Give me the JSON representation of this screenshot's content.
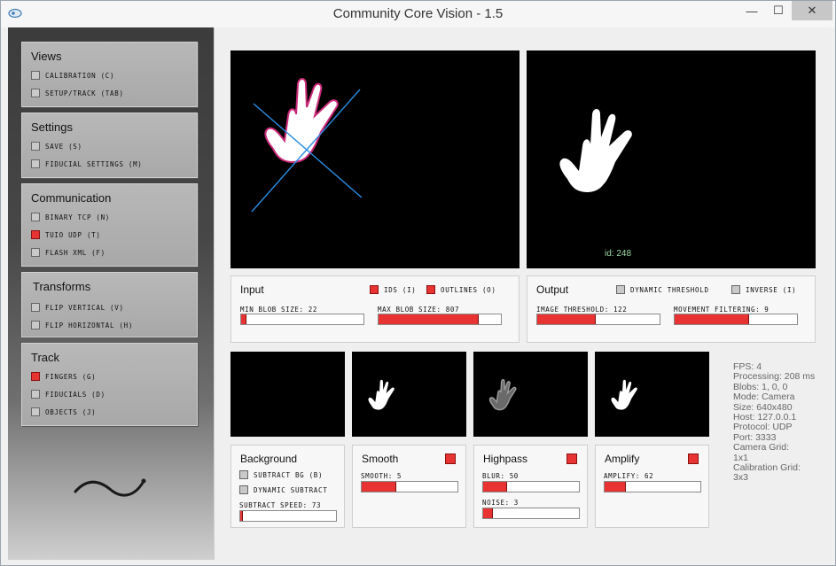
{
  "window": {
    "title": "Community Core Vision - 1.5"
  },
  "titlebar": {
    "minimize_symbol": "—",
    "maximize_symbol": "☐",
    "close_symbol": "✕"
  },
  "sidebar": {
    "views": {
      "title": "Views",
      "items": [
        {
          "label": "CALIBRATION (C)",
          "checked": false
        },
        {
          "label": "SETUP/TRACK (TAB)",
          "checked": false
        }
      ]
    },
    "settings": {
      "title": "Settings",
      "items": [
        {
          "label": "SAVE (S)",
          "checked": false
        },
        {
          "label": "FIDUCIAL SETTINGS (M)",
          "checked": false
        }
      ]
    },
    "communication": {
      "title": "Communication",
      "items": [
        {
          "label": "BINARY TCP (N)",
          "checked": false
        },
        {
          "label": "TUIO UDP (T)",
          "checked": true
        },
        {
          "label": "FLASH XML (F)",
          "checked": false
        }
      ]
    },
    "transforms": {
      "title": "Transforms",
      "items": [
        {
          "label": "FLIP VERTICAL (V)",
          "checked": false
        },
        {
          "label": "FLIP HORIZONTAL (H)",
          "checked": false
        }
      ]
    },
    "track": {
      "title": "Track",
      "items": [
        {
          "label": "FINGERS (G)",
          "checked": true
        },
        {
          "label": "FIDUCIALS (D)",
          "checked": false
        },
        {
          "label": "OBJECTS (J)",
          "checked": false
        }
      ]
    }
  },
  "output_view": {
    "blob_id": "id: 248"
  },
  "input": {
    "title": "Input",
    "ids_label": "IDS (I)",
    "ids_checked": true,
    "outlines_label": "OUTLINES (O)",
    "outlines_checked": true,
    "min_blob_label": "MIN BLOB SIZE: 22",
    "min_blob_fill": 0.04,
    "max_blob_label": "MAX BLOB SIZE: 807",
    "max_blob_fill": 0.82
  },
  "output": {
    "title": "Output",
    "dynamic_threshold_label": "DYNAMIC THRESHOLD",
    "dynamic_threshold_checked": false,
    "inverse_label": "INVERSE (I)",
    "inverse_checked": false,
    "image_threshold_label": "IMAGE THRESHOLD: 122",
    "image_threshold_fill": 0.48,
    "movement_filtering_label": "MOVEMENT FILTERING: 9",
    "movement_filtering_fill": 0.61
  },
  "filters": {
    "background": {
      "title": "Background",
      "subtract_bg_label": "SUBTRACT BG (B)",
      "subtract_bg_checked": false,
      "dynamic_subtract_label": "DYNAMIC SUBTRACT",
      "dynamic_subtract_checked": false,
      "subtract_speed_label": "SUBTRACT SPEED: 73",
      "subtract_speed_fill": 0.03
    },
    "smooth": {
      "title": "Smooth",
      "enabled": true,
      "slider_label": "SMOOTH: 5",
      "slider_fill": 0.36
    },
    "highpass": {
      "title": "Highpass",
      "enabled": true,
      "blur_label": "BLUR: 50",
      "blur_fill": 0.25,
      "noise_label": "NOISE: 3",
      "noise_fill": 0.1
    },
    "amplify": {
      "title": "Amplify",
      "enabled": true,
      "slider_label": "AMPLIFY: 62",
      "slider_fill": 0.22
    }
  },
  "stats": {
    "fps": "FPS: 4",
    "processing": "Processing: 208 ms",
    "blobs": "Blobs: 1, 0, 0",
    "mode": "Mode: Camera",
    "size": "Size: 640x480",
    "host": "Host: 127.0.0.1",
    "protocol": "Protocol: UDP",
    "port": "Port: 3333",
    "camera_grid_label": "Camera Grid:",
    "camera_grid_value": "1x1",
    "calibration_grid_label": "Calibration Grid:",
    "calibration_grid_value": "3x3"
  },
  "colors": {
    "accent_red": "#e83333",
    "blob_outline": "#cc2a7a",
    "crosshair": "#2a8ce0",
    "id_text": "#9ed8a8"
  }
}
